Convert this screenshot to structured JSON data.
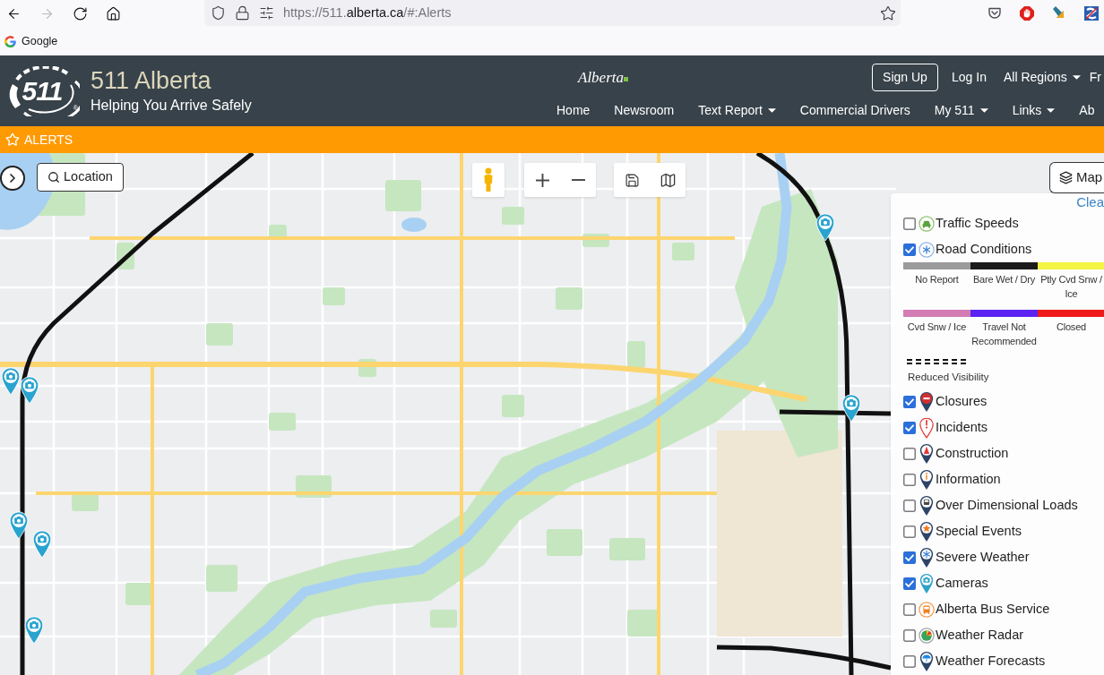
{
  "browser": {
    "forward_disabled": true,
    "url": "https://511.**alberta.ca**/#:Alerts",
    "bookmarks": [
      {
        "label": "Google"
      }
    ]
  },
  "header": {
    "logo": {
      "text": "511",
      "mark": "®"
    },
    "title": "511 Alberta",
    "tagline": "Helping You Arrive Safely",
    "gov_logo": "Alberta",
    "account_links": [
      {
        "label": "Sign Up",
        "kind": "button"
      },
      {
        "label": "Log In",
        "kind": "link"
      },
      {
        "label": "All Regions",
        "kind": "dropdown"
      },
      {
        "label": "Fr",
        "kind": "link"
      }
    ],
    "nav": [
      {
        "label": "Home",
        "dropdown": false
      },
      {
        "label": "Newsroom",
        "dropdown": false
      },
      {
        "label": "Text Report",
        "dropdown": true
      },
      {
        "label": "Commercial Drivers",
        "dropdown": false
      },
      {
        "label": "My 511",
        "dropdown": true
      },
      {
        "label": "Links",
        "dropdown": true
      },
      {
        "label": "Ab",
        "dropdown": false
      }
    ]
  },
  "alerts_bar": {
    "label": "ALERTS"
  },
  "map": {
    "location_button": "Location",
    "layers_button": "Map",
    "legend": {
      "clear_link": "Clea",
      "layers": [
        {
          "label": "Traffic Speeds",
          "checked": false,
          "kind": "car"
        },
        {
          "label": "Road Conditions",
          "checked": true,
          "kind": "snowflake",
          "key": [
            {
              "label": "No Report",
              "color": "#9b9b9b"
            },
            {
              "label": "Bare Wet / Dry",
              "color": "#1b1b1b"
            },
            {
              "label": "Ptly Cvd Snw / Ice",
              "color": "#f4f442"
            },
            {
              "label": "Cvd Snw / Ice",
              "color": "#d47cb4"
            },
            {
              "label": "Travel Not Recommended",
              "color": "#5b24f2"
            },
            {
              "label": "Closed",
              "color": "#ef1b1b"
            }
          ],
          "dashed_line_label": "Reduced Visibility"
        },
        {
          "label": "Closures",
          "checked": true,
          "kind": "closure"
        },
        {
          "label": "Incidents",
          "checked": true,
          "kind": "incident"
        },
        {
          "label": "Construction",
          "checked": false,
          "kind": "construction"
        },
        {
          "label": "Information",
          "checked": false,
          "kind": "info"
        },
        {
          "label": "Over Dimensional Loads",
          "checked": false,
          "kind": "truck"
        },
        {
          "label": "Special Events",
          "checked": false,
          "kind": "event"
        },
        {
          "label": "Severe Weather",
          "checked": true,
          "kind": "weather"
        },
        {
          "label": "Cameras",
          "checked": true,
          "kind": "camera"
        },
        {
          "label": "Alberta Bus Service",
          "checked": false,
          "kind": "bus"
        },
        {
          "label": "Weather Radar",
          "checked": false,
          "kind": "radar"
        },
        {
          "label": "Weather Forecasts",
          "checked": false,
          "kind": "forecast"
        }
      ]
    }
  }
}
